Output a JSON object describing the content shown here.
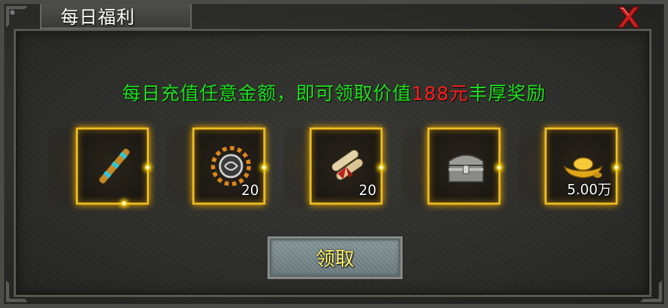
{
  "window": {
    "title": "每日福利",
    "close_icon": "close-x-icon"
  },
  "headline": {
    "prefix": "每日充值任意金额，即可领取价值",
    "amount": "188元",
    "suffix": "丰厚奖励"
  },
  "rewards": [
    {
      "icon": "scroll-staff-icon",
      "quantity": ""
    },
    {
      "icon": "sun-rune-icon",
      "quantity": "20"
    },
    {
      "icon": "scroll-bundle-icon",
      "quantity": "20"
    },
    {
      "icon": "treasure-chest-icon",
      "quantity": ""
    },
    {
      "icon": "gold-ingot-icon",
      "quantity": "5.00万"
    }
  ],
  "claim_button": {
    "label": "领取"
  },
  "colors": {
    "headline_green": "#1de01d",
    "amount_red": "#ff1e1e",
    "slot_gold": "#e8b923",
    "button_text": "#fff36a"
  }
}
